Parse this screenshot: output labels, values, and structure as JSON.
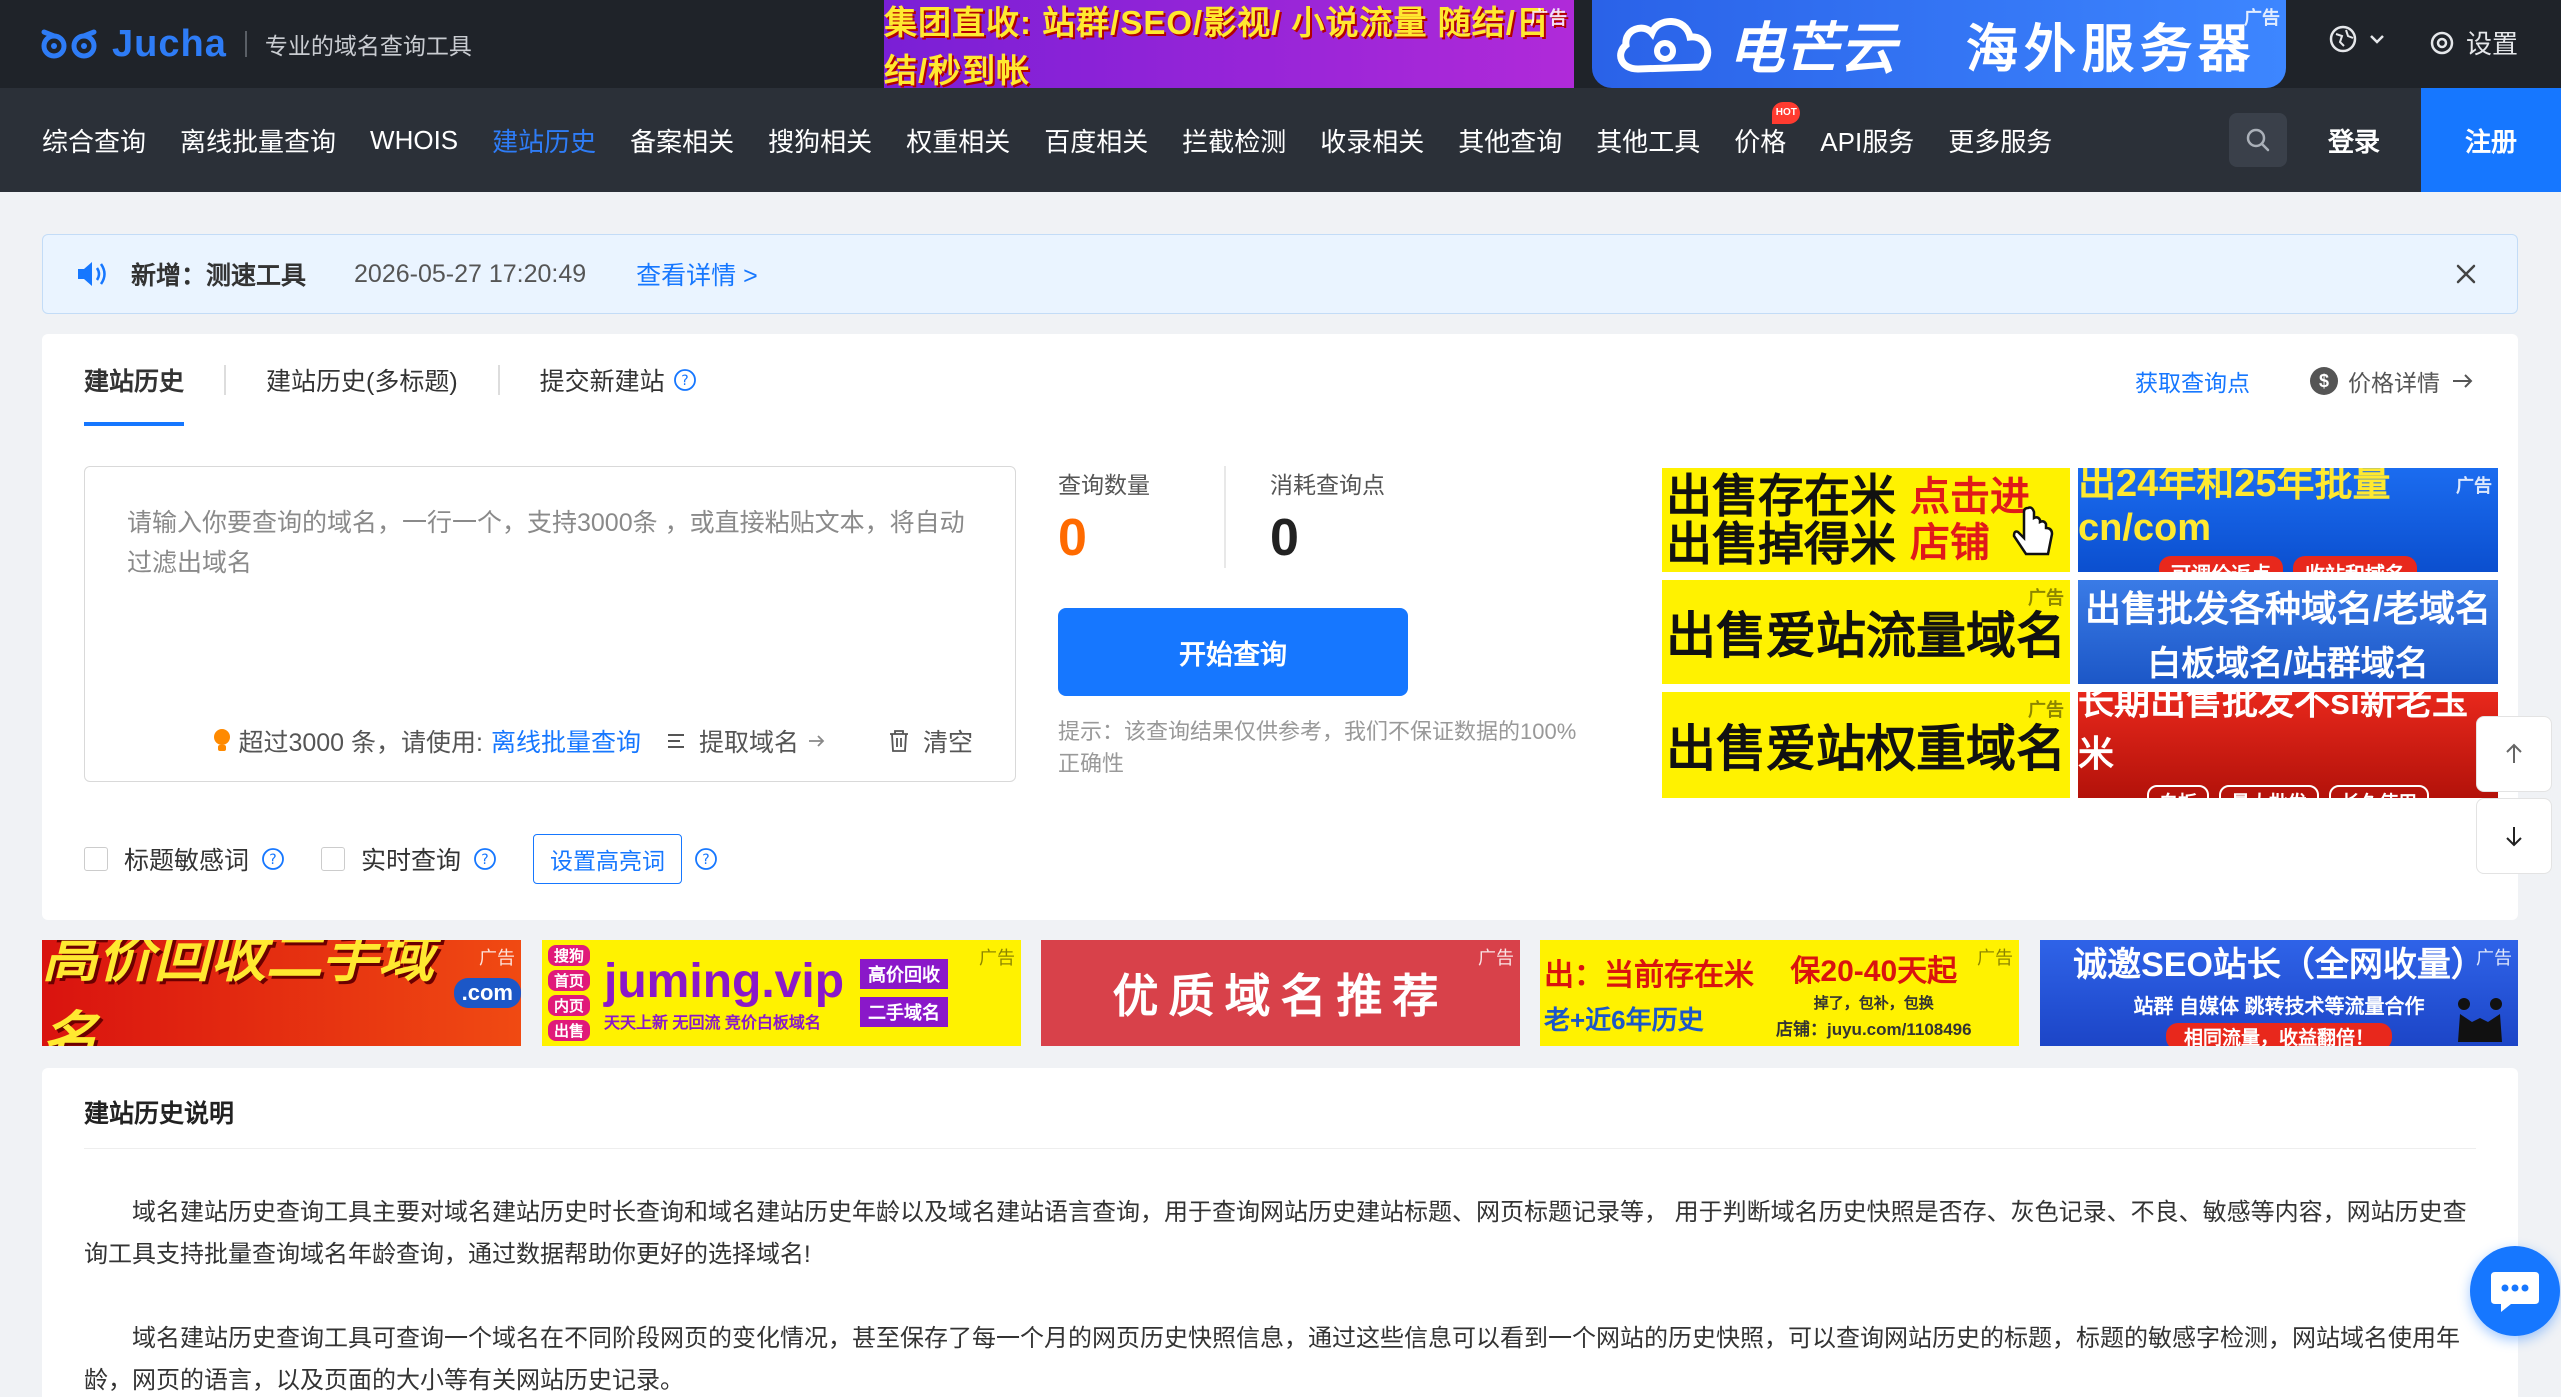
{
  "brand": {
    "name": "Jucha",
    "tagline": "专业的域名查询工具",
    "accent": "#1677ff"
  },
  "top_ads": {
    "ad1_text": "集团直收: 站群/SEO/影视/ 小说流量 随结/日结/秒到帐",
    "ad2_brand": "电芒云",
    "ad2_slogan": "海外服务器",
    "ad_label": "广告"
  },
  "top_right": {
    "lang_icon": "globe-icon",
    "settings_label": "设置"
  },
  "nav": {
    "items": [
      {
        "label": "综合查询"
      },
      {
        "label": "离线批量查询"
      },
      {
        "label": "WHOIS"
      },
      {
        "label": "建站历史"
      },
      {
        "label": "备案相关"
      },
      {
        "label": "搜狗相关"
      },
      {
        "label": "权重相关"
      },
      {
        "label": "百度相关"
      },
      {
        "label": "拦截检测"
      },
      {
        "label": "收录相关"
      },
      {
        "label": "其他查询"
      },
      {
        "label": "其他工具"
      },
      {
        "label": "价格"
      },
      {
        "label": "API服务"
      },
      {
        "label": "更多服务"
      }
    ],
    "active_index": 3,
    "hot_badge": "HOT",
    "login": "登录",
    "register": "注册"
  },
  "notice": {
    "title": "新增：测速工具",
    "time": "2026-05-27 17:20:49",
    "link": "查看详情 >"
  },
  "tabs": {
    "items": [
      {
        "label": "建站历史"
      },
      {
        "label": "建站历史(多标题)"
      },
      {
        "label": "提交新建站"
      }
    ],
    "get_points": "获取查询点",
    "price_detail": "价格详情"
  },
  "input": {
    "placeholder": "请输入你要查询的域名，一行一个，支持3000条 ，或直接粘贴文本，将自动过滤出域名",
    "limit_hint": "超过3000 条，请使用:",
    "offline_link": "离线批量查询",
    "extract_label": "提取域名",
    "clear_label": "清空"
  },
  "stats": {
    "qty_label": "查询数量",
    "qty_value": "0",
    "cost_label": "消耗查询点",
    "cost_value": "0"
  },
  "actions": {
    "start_button": "开始查询",
    "tip": "提示：该查询结果仅供参考，我们不保证数据的100%正确性"
  },
  "options": {
    "title_sensitive": "标题敏感词",
    "realtime": "实时查询",
    "highlight_button": "设置高亮词"
  },
  "grid_ads": {
    "a1_l1": "出售存在米",
    "a1_l2": "出售掉得米",
    "a1_r1": "点击进",
    "a1_r2": "店铺",
    "a2_title": "出24年和25年批量cn/com",
    "a2_p1": "可调价返点",
    "a2_p2": "收站和域名",
    "a3": "出售爱站流量域名",
    "a4_l1": "出售批发各种域名/老域名",
    "a4_l2": "白板域名/站群域名",
    "a5": "出售爱站权重域名",
    "a6_title": "长期出售批发不si新老玉米",
    "a6_p1": "白板",
    "a6_p2": "量大批发",
    "a6_p3": "长久使用"
  },
  "banners": {
    "b1_main": "高价回收二手域名",
    "b1_sub": ".com",
    "b2_main": "juming.vip",
    "b2_tags": [
      "搜狗",
      "首页",
      "内页",
      "出售"
    ],
    "b2_sub": "天天上新 无回流 竞价白板域名",
    "b2_r1": "高价回收",
    "b2_r2": "二手域名",
    "b3": "优质域名推荐",
    "b4_l1": "出：当前存在米",
    "b4_l2": "老+近6年历史",
    "b4_r1": "保20-40天起",
    "b4_r2": "掉了，包补，包换",
    "b4_r3": "店铺：juyu.com/1108496",
    "b5_title": "诚邀SEO站长（全网收量）",
    "b5_sub": "站群 自媒体 跳转技术等流量合作",
    "b5_foot": "相同流量，收益翻倍！"
  },
  "description": {
    "title": "建站历史说明",
    "p1": "域名建站历史查询工具主要对域名建站历史时长查询和域名建站历史年龄以及域名建站语言查询，用于查询网站历史建站标题、网页标题记录等， 用于判断域名历史快照是否存、灰色记录、不良、敏感等内容，网站历史查询工具支持批量查询域名年龄查询，通过数据帮助你更好的选择域名!",
    "p2": "域名建站历史查询工具可查询一个域名在不同阶段网页的变化情况，甚至保存了每一个月的网页历史快照信息，通过这些信息可以看到一个网站的历史快照，可以查询网站历史的标题，标题的敏感字检测，网站域名使用年龄，网页的语言，以及页面的大小等有关网站历史记录。"
  }
}
